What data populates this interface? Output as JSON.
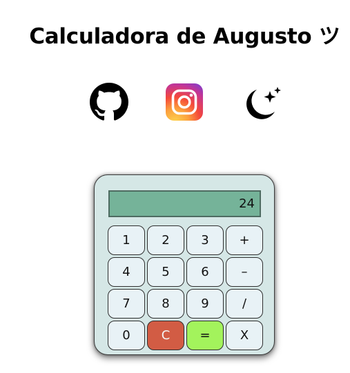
{
  "header": {
    "title": "Calculadora de Augusto ツ"
  },
  "links": [
    {
      "icon": "github-icon"
    },
    {
      "icon": "instagram-icon"
    },
    {
      "icon": "moon-stars-icon"
    }
  ],
  "calculator": {
    "display_value": "24",
    "keys": [
      [
        "1",
        "2",
        "3",
        "+"
      ],
      [
        "4",
        "5",
        "6",
        "–"
      ],
      [
        "7",
        "8",
        "9",
        "/"
      ],
      [
        "0",
        "C",
        "=",
        "X"
      ]
    ]
  },
  "colors": {
    "calculator_body": "#d5e7e6",
    "display": "#75b399",
    "key": "#e8f2f6",
    "clear_key": "#d25c44",
    "equals_key": "#a3f35c",
    "instagram_gradient": [
      "#fcc84a",
      "#f4483a",
      "#c53593",
      "#7c3ed0"
    ]
  }
}
